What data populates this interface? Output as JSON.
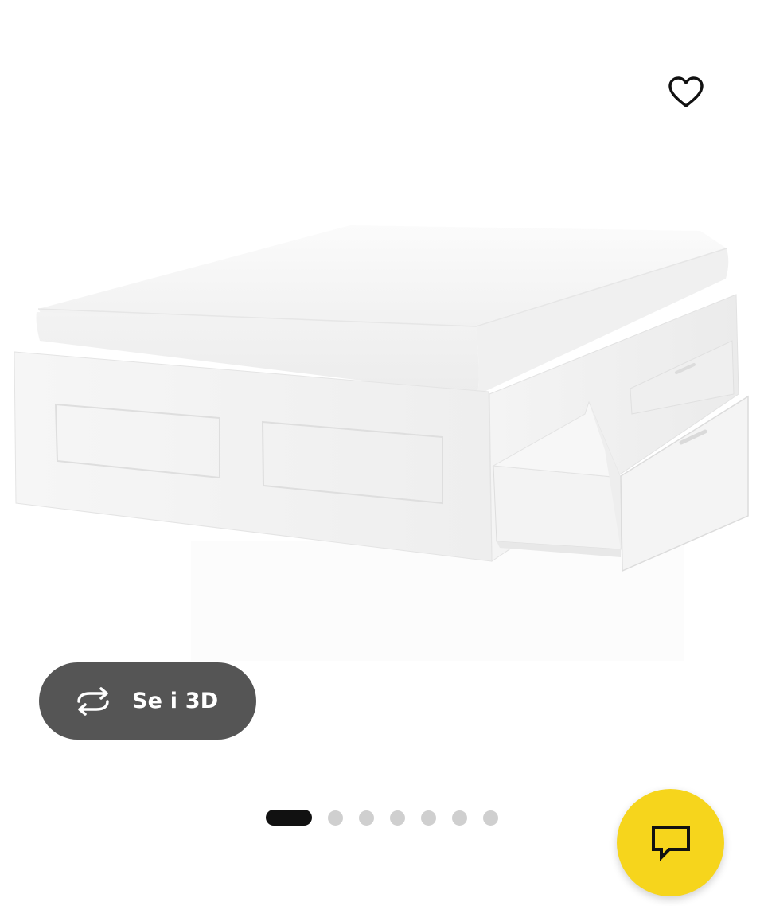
{
  "product": {
    "image_subject": "bed-frame-with-storage-drawers"
  },
  "actions": {
    "favorite_icon": "heart-outline-icon",
    "view_3d_label": "Se i 3D",
    "view_3d_icon": "rotate-3d-icon",
    "chat_icon": "chat-bubble-icon"
  },
  "pager": {
    "total": 7,
    "active_index": 0
  },
  "colors": {
    "view_3d_button_bg": "#555555",
    "chat_button_bg": "#f6d51c",
    "pager_active": "#111111",
    "pager_inactive": "#cfcfcf"
  }
}
